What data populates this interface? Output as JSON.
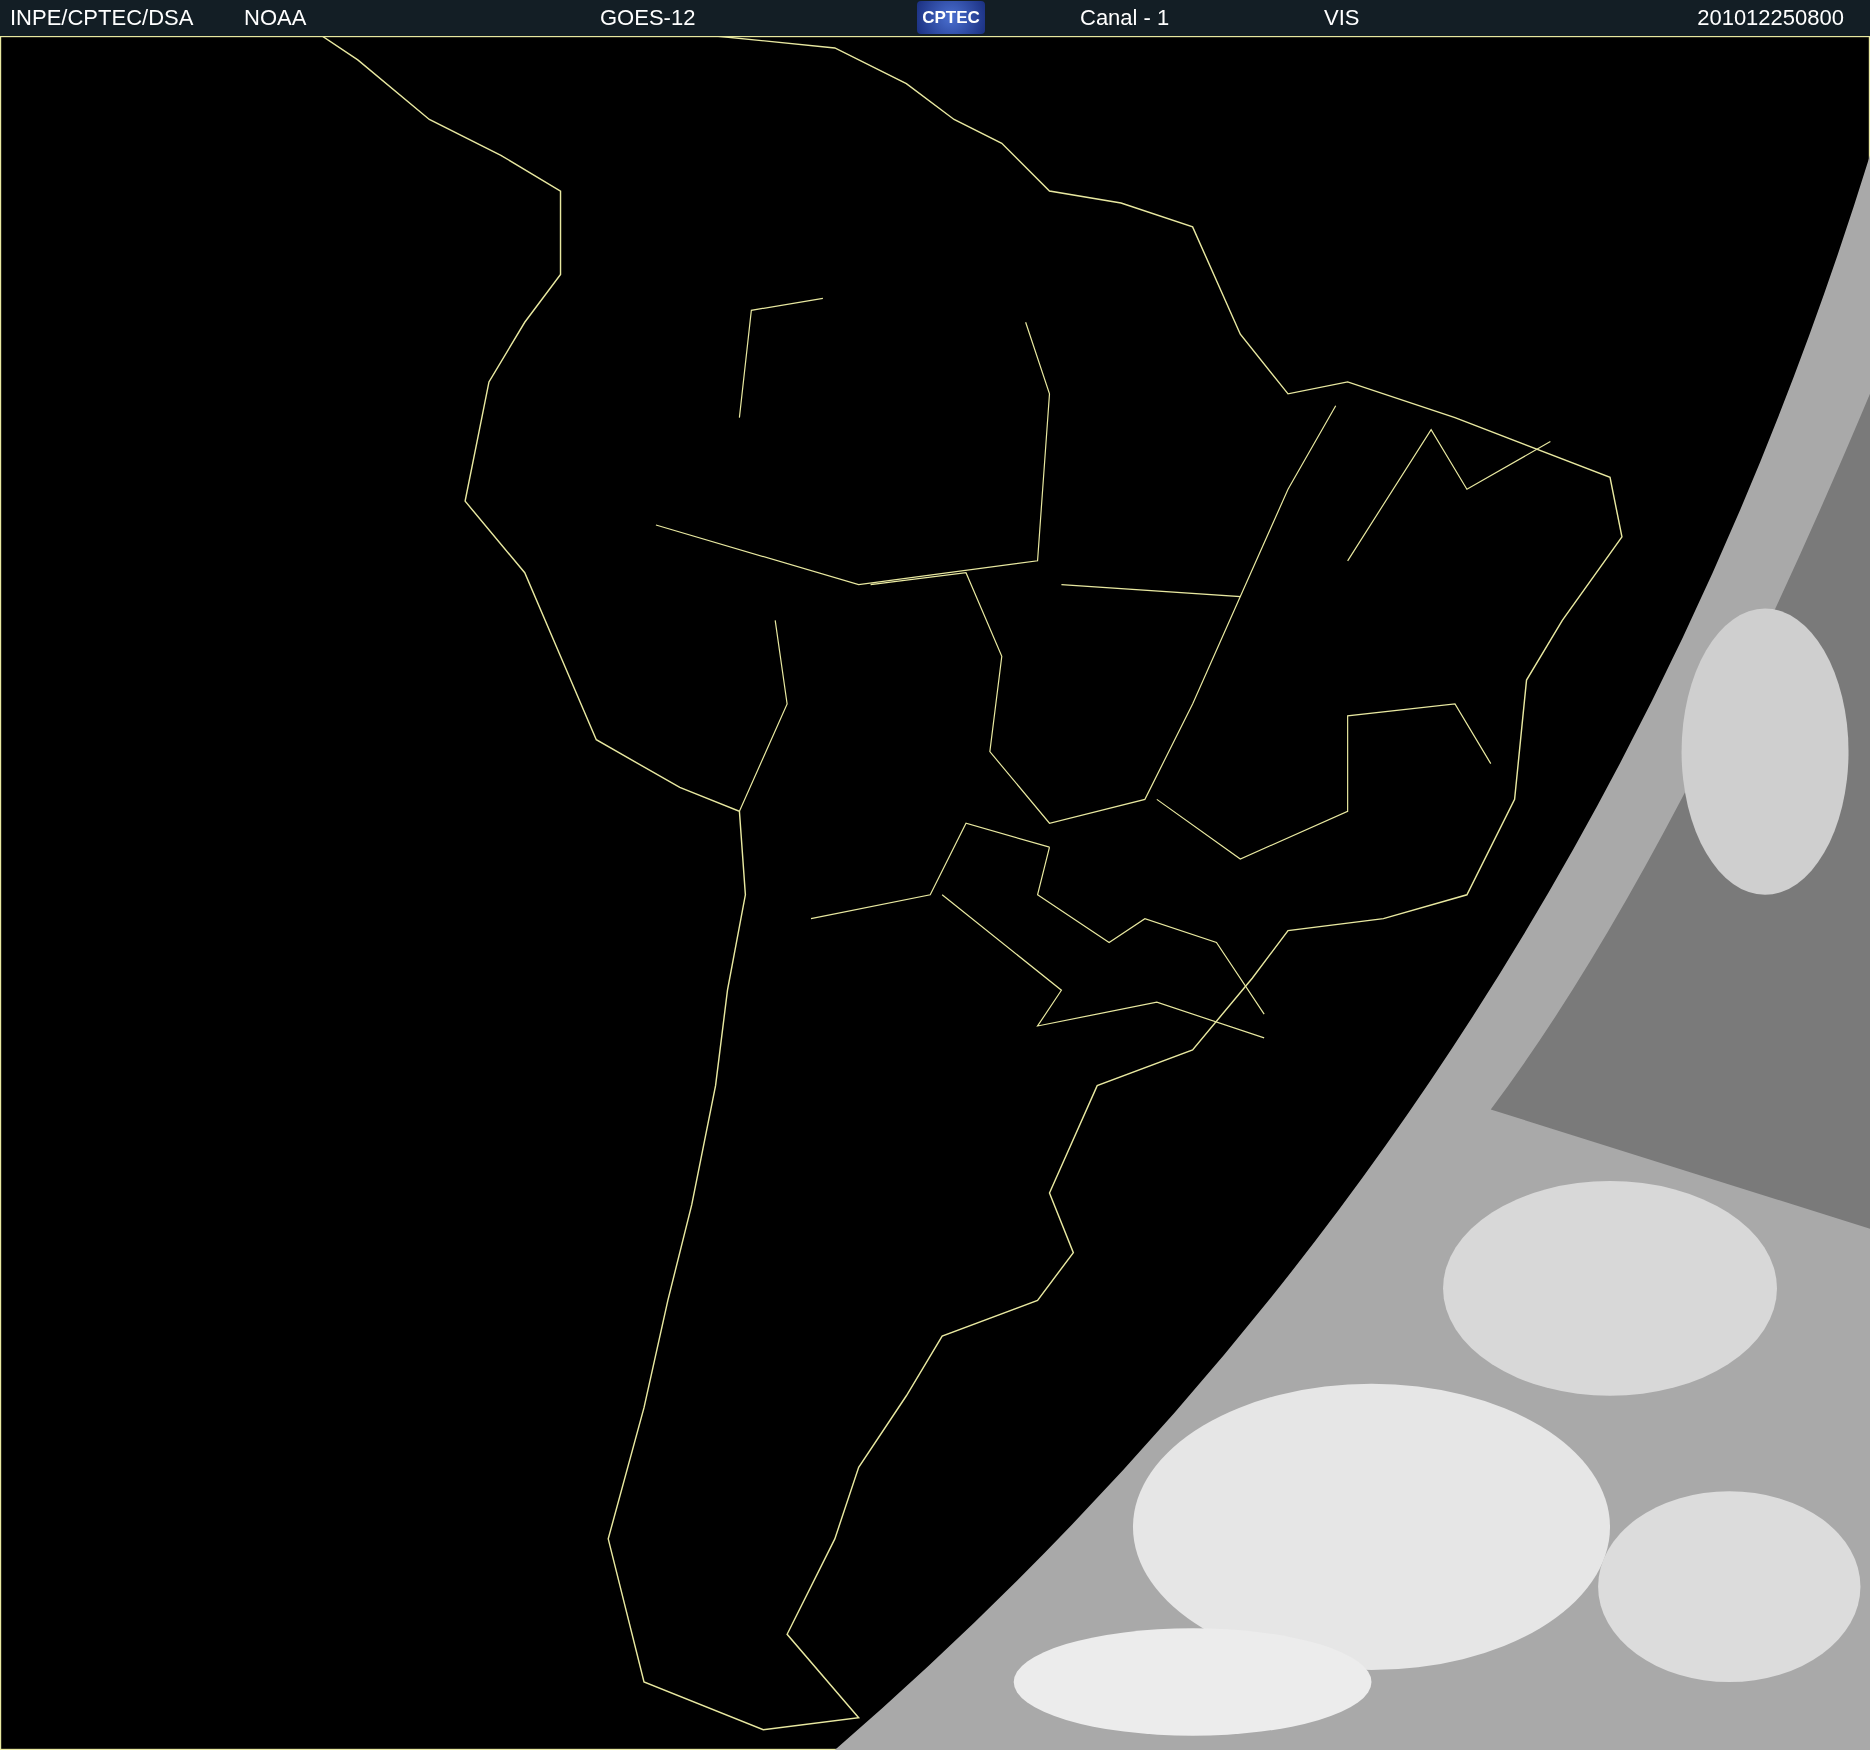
{
  "header": {
    "source": "INPE/CPTEC/DSA",
    "agency": "NOAA",
    "satellite": "GOES-12",
    "logo_text": "CPTEC",
    "channel": "Canal - 1",
    "band": "VIS",
    "timestamp": "201012250800"
  }
}
